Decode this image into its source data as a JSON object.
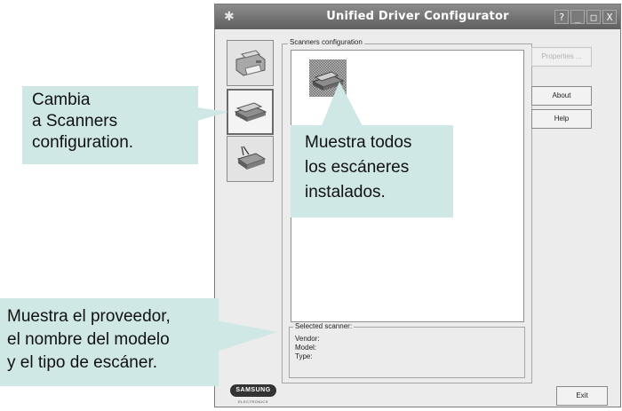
{
  "window": {
    "title": "Unified Driver Configurator",
    "controls": [
      "?",
      "_",
      "□",
      "X"
    ]
  },
  "nav": [
    {
      "name": "printers",
      "icon": "printer-icon"
    },
    {
      "name": "scanners",
      "icon": "scanner-icon",
      "active": true
    },
    {
      "name": "ports",
      "icon": "port-icon"
    }
  ],
  "group": {
    "legend": "Scanners configuration",
    "selected": {
      "legend": "Selected scanner:",
      "vendor_label": "Vendor:",
      "model_label": "Model:",
      "type_label": "Type:"
    }
  },
  "buttons": {
    "properties": "Properties ...",
    "about": "About",
    "help": "Help",
    "exit": "Exit"
  },
  "logo": {
    "brand": "SAMSUNG",
    "sub": "ELECTRONICS"
  },
  "callouts": {
    "switch": "Cambia\na Scanners\nconfiguration.",
    "list": "Muestra todos\nlos escáneres\ninstalados.",
    "selected": "Muestra el proveedor,\nel nombre del modelo\ny el tipo de escáner."
  }
}
